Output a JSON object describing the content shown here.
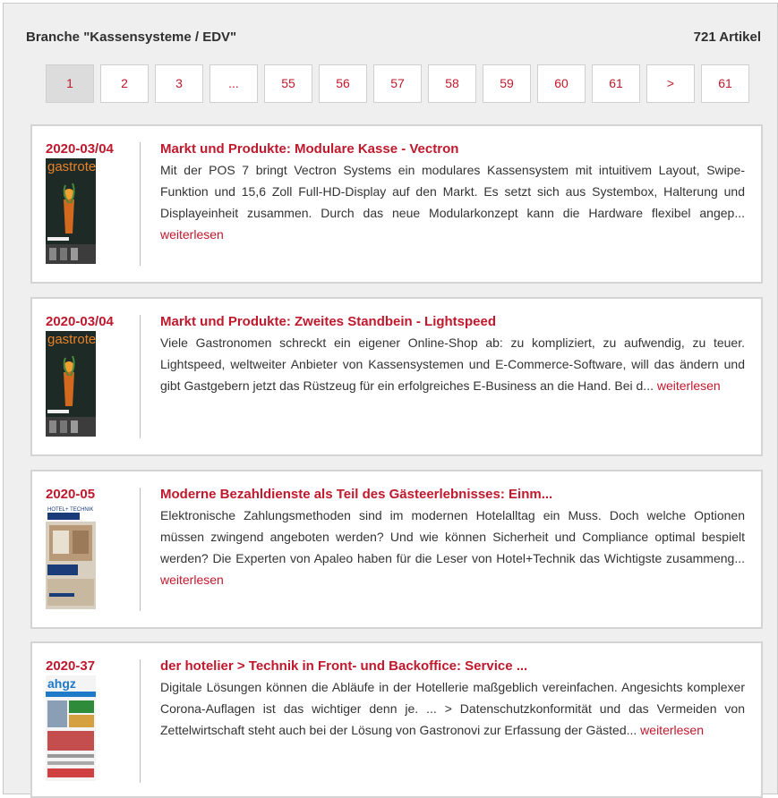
{
  "header": {
    "branch_label": "Branche \"Kassensysteme / EDV\"",
    "count_label": "721 Artikel"
  },
  "pagination": [
    "1",
    "2",
    "3",
    "...",
    "55",
    "56",
    "57",
    "58",
    "59",
    "60",
    "61",
    ">",
    "61"
  ],
  "articles": [
    {
      "date": "2020-03/04",
      "cover": "gastrotel",
      "title": "Markt und Produkte: Modulare Kasse - Vectron",
      "teaser": "Mit der POS 7 bringt Vectron Systems ein modulares Kassensystem mit intuitivem Layout, Swipe-Funktion und 15,6 Zoll Full-HD-Display auf den Markt. Es setzt sich aus Systembox, Halterung und Displayeinheit zusammen. Durch das neue Modularkonzept kann die Hardware flexibel angep...",
      "more": "weiterlesen"
    },
    {
      "date": "2020-03/04",
      "cover": "gastrotel",
      "title": "Markt und Produkte: Zweites Standbein - Lightspeed",
      "teaser": "Viele Gastronomen schreckt ein eigener Online-Shop ab: zu kompliziert, zu aufwendig, zu teuer. Lightspeed, weltweiter Anbieter von Kassensystemen und E-Commerce-Software, will das ändern und gibt Gastgebern jetzt das Rüstzeug für ein erfolgreiches E-Business an die Hand. Bei d...",
      "more": "weiterlesen"
    },
    {
      "date": "2020-05",
      "cover": "HOTEL+ TECHNIK",
      "title": "Moderne Bezahldienste als Teil des Gästeerlebnisses: Einm...",
      "teaser": "Elektronische Zahlungsmethoden sind im modernen Hotelalltag ein Muss. Doch welche Optionen müssen zwingend angeboten werden? Und wie können Sicherheit und Compliance optimal bespielt werden? Die Experten von Apaleo haben für die Leser von Hotel+Technik das Wichtigste zusammeng...",
      "more": "weiterlesen"
    },
    {
      "date": "2020-37",
      "cover": "ahgz",
      "title": "der hotelier > Technik in Front- und Backoffice: Service ...",
      "teaser": "Digitale Lösungen können die Abläufe in der Hotellerie maßgeblich vereinfachen. Angesichts komplexer Corona-Auflagen ist das wichtiger denn je. ... > Datenschutzkonformität und das Vermeiden von Zettelwirtschaft steht auch bei der Lösung von Gastronovi zur Erfassung der Gästed...",
      "more": "weiterlesen"
    }
  ]
}
